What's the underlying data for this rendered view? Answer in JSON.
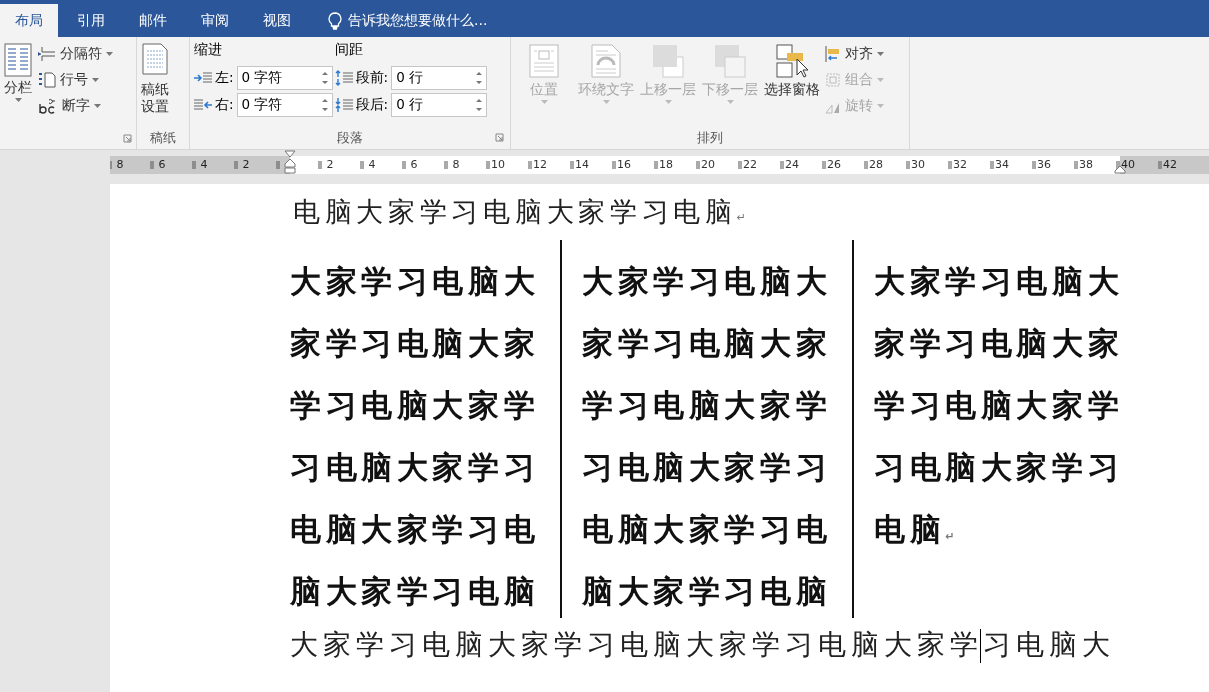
{
  "tabs": [
    {
      "label": "布局",
      "selected": true
    },
    {
      "label": "引用",
      "selected": false
    },
    {
      "label": "邮件",
      "selected": false
    },
    {
      "label": "审阅",
      "selected": false
    },
    {
      "label": "视图",
      "selected": false
    }
  ],
  "tell_me": {
    "placeholder": "告诉我您想要做什么..."
  },
  "page_setup": {
    "columns_button": "分栏",
    "small_buttons": [
      {
        "label": "分隔符",
        "kind": "breaks"
      },
      {
        "label": "行号",
        "kind": "lines"
      },
      {
        "label": "断字",
        "kind": "hyphen"
      }
    ]
  },
  "manuscript": {
    "button_line1": "稿纸",
    "button_line2": "设置",
    "group_label": "稿纸"
  },
  "paragraph": {
    "indent_heading": "缩进",
    "spacing_heading": "间距",
    "group_label": "段落",
    "indent_fields": [
      {
        "label": "左:",
        "value": "0 字符",
        "kind": "left"
      },
      {
        "label": "右:",
        "value": "0 字符",
        "kind": "right"
      }
    ],
    "spacing_fields": [
      {
        "label": "段前:",
        "value": "0 行",
        "kind": "before"
      },
      {
        "label": "段后:",
        "value": "0 行",
        "kind": "after"
      }
    ]
  },
  "arrange": {
    "group_label": "排列",
    "big_buttons": [
      {
        "label": "位置",
        "kind": "position",
        "disabled": true
      },
      {
        "label": "环绕文字",
        "kind": "wrap",
        "disabled": true
      },
      {
        "label": "上移一层",
        "kind": "forward",
        "disabled": true
      },
      {
        "label": "下移一层",
        "kind": "backward",
        "disabled": true
      },
      {
        "label": "选择窗格",
        "kind": "pane",
        "disabled": false
      }
    ],
    "small_buttons": [
      {
        "label": "对齐",
        "kind": "align",
        "disabled": false
      },
      {
        "label": "组合",
        "kind": "group",
        "disabled": true
      },
      {
        "label": "旋转",
        "kind": "rotate",
        "disabled": true
      }
    ]
  },
  "ruler": {
    "labels": [
      {
        "text": "8",
        "margin": true
      },
      {
        "text": "6",
        "margin": true
      },
      {
        "text": "4",
        "margin": true
      },
      {
        "text": "2",
        "margin": true
      },
      {
        "text": "2",
        "margin": false
      },
      {
        "text": "4",
        "margin": false
      },
      {
        "text": "6",
        "margin": false
      },
      {
        "text": "8",
        "margin": false
      },
      {
        "text": "10",
        "margin": false
      },
      {
        "text": "12",
        "margin": false
      },
      {
        "text": "14",
        "margin": false
      },
      {
        "text": "16",
        "margin": false
      },
      {
        "text": "18",
        "margin": false
      },
      {
        "text": "20",
        "margin": false
      },
      {
        "text": "22",
        "margin": false
      },
      {
        "text": "24",
        "margin": false
      },
      {
        "text": "26",
        "margin": false
      },
      {
        "text": "28",
        "margin": false
      },
      {
        "text": "30",
        "margin": false
      },
      {
        "text": "32",
        "margin": false
      },
      {
        "text": "34",
        "margin": false
      },
      {
        "text": "36",
        "margin": false
      },
      {
        "text": "38",
        "margin": false
      },
      {
        "text": "40",
        "margin": true
      },
      {
        "text": "42",
        "margin": true
      }
    ]
  },
  "document": {
    "first_line": {
      "text": "电脑大家学习电脑大家学习电脑",
      "paragraph_mark": "↵"
    },
    "columns": [
      {
        "lines": [
          "大家学习电脑大",
          "家学习电脑大家",
          "学习电脑大家学",
          "习电脑大家学习",
          "电脑大家学习电",
          "脑大家学习电脑"
        ]
      },
      {
        "lines": [
          "大家学习电脑大",
          "家学习电脑大家",
          "学习电脑大家学",
          "习电脑大家学习",
          "电脑大家学习电",
          "脑大家学习电脑"
        ]
      },
      {
        "lines": [
          "大家学习电脑大",
          "家学习电脑大家",
          "学习电脑大家学",
          "习电脑大家学习",
          "电脑"
        ],
        "paragraph_mark": "↵"
      }
    ],
    "last_line": {
      "before_cursor": "大家学习电脑大家学习电脑大家学习电脑大家学",
      "after_cursor": "习电脑大"
    }
  }
}
